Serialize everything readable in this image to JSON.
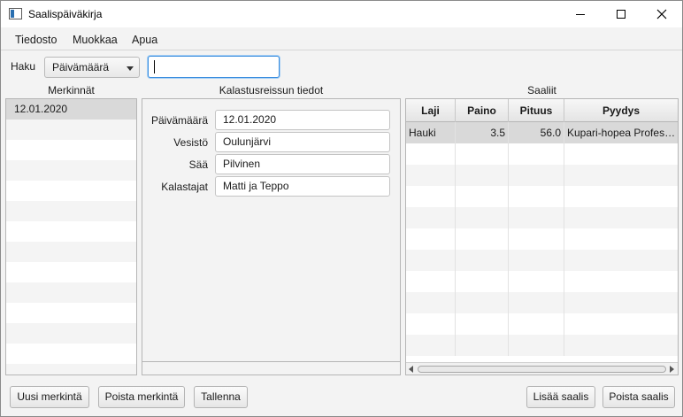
{
  "window": {
    "title": "Saalispäiväkirja"
  },
  "menu": [
    "Tiedosto",
    "Muokkaa",
    "Apua"
  ],
  "search": {
    "label": "Haku",
    "field_selected": "Päivämäärä",
    "value": ""
  },
  "entries": {
    "title": "Merkinnät",
    "items": [
      "12.01.2020"
    ],
    "selected_index": 0
  },
  "details": {
    "title": "Kalastusreissun tiedot",
    "fields": [
      {
        "label": "Päivämäärä",
        "value": "12.01.2020"
      },
      {
        "label": "Vesistö",
        "value": "Oulunjärvi"
      },
      {
        "label": "Sää",
        "value": "Pilvinen"
      },
      {
        "label": "Kalastajat",
        "value": "Matti ja Teppo"
      }
    ]
  },
  "catches": {
    "title": "Saaliit",
    "columns": [
      "Laji",
      "Paino",
      "Pituus",
      "Pyydys"
    ],
    "rows": [
      [
        "Hauki",
        "3.5",
        "56.0",
        "Kupari-hopea Profes…"
      ]
    ],
    "selected_index": 0
  },
  "buttons": {
    "new_entry": "Uusi merkintä",
    "delete_entry": "Poista merkintä",
    "save": "Tallenna",
    "add_catch": "Lisää saalis",
    "delete_catch": "Poista saalis"
  },
  "icons": [
    "app-icon",
    "minimize-icon",
    "maximize-icon",
    "close-icon",
    "chevron-down-icon"
  ]
}
